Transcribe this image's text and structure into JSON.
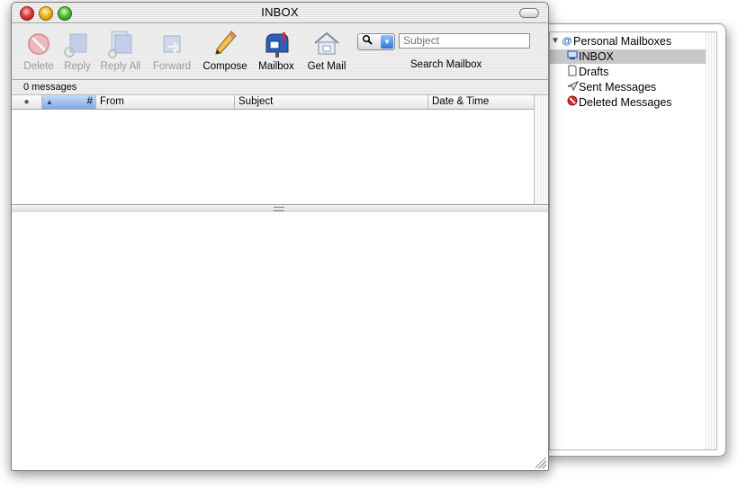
{
  "window": {
    "title": "INBOX"
  },
  "toolbar": {
    "buttons": [
      {
        "label": "Delete",
        "icon": "delete-icon",
        "enabled": false
      },
      {
        "label": "Reply",
        "icon": "reply-icon",
        "enabled": false
      },
      {
        "label": "Reply All",
        "icon": "reply-all-icon",
        "enabled": false
      },
      {
        "label": "Forward",
        "icon": "forward-icon",
        "enabled": false
      },
      {
        "label": "Compose",
        "icon": "pencil-icon",
        "enabled": true
      },
      {
        "label": "Mailbox",
        "icon": "mailbox-icon",
        "enabled": true
      },
      {
        "label": "Get Mail",
        "icon": "house-mail-icon",
        "enabled": true
      }
    ],
    "search": {
      "placeholder": "Subject",
      "label": "Search Mailbox"
    }
  },
  "status": {
    "message_count": "0 messages"
  },
  "columns": {
    "dot": "●",
    "num": "#",
    "from": "From",
    "subject": "Subject",
    "date": "Date & Time"
  },
  "drawer": {
    "root": "Personal Mailboxes",
    "items": [
      {
        "label": "INBOX",
        "icon": "inbox-icon",
        "selected": true
      },
      {
        "label": "Drafts",
        "icon": "document-icon",
        "selected": false
      },
      {
        "label": "Sent Messages",
        "icon": "paper-plane-icon",
        "selected": false
      },
      {
        "label": "Deleted Messages",
        "icon": "no-entry-icon",
        "selected": false
      }
    ]
  },
  "colors": {
    "accent": "#2f74d8",
    "selection": "#c8c8c8",
    "disabled_text": "#9a9a9a"
  }
}
